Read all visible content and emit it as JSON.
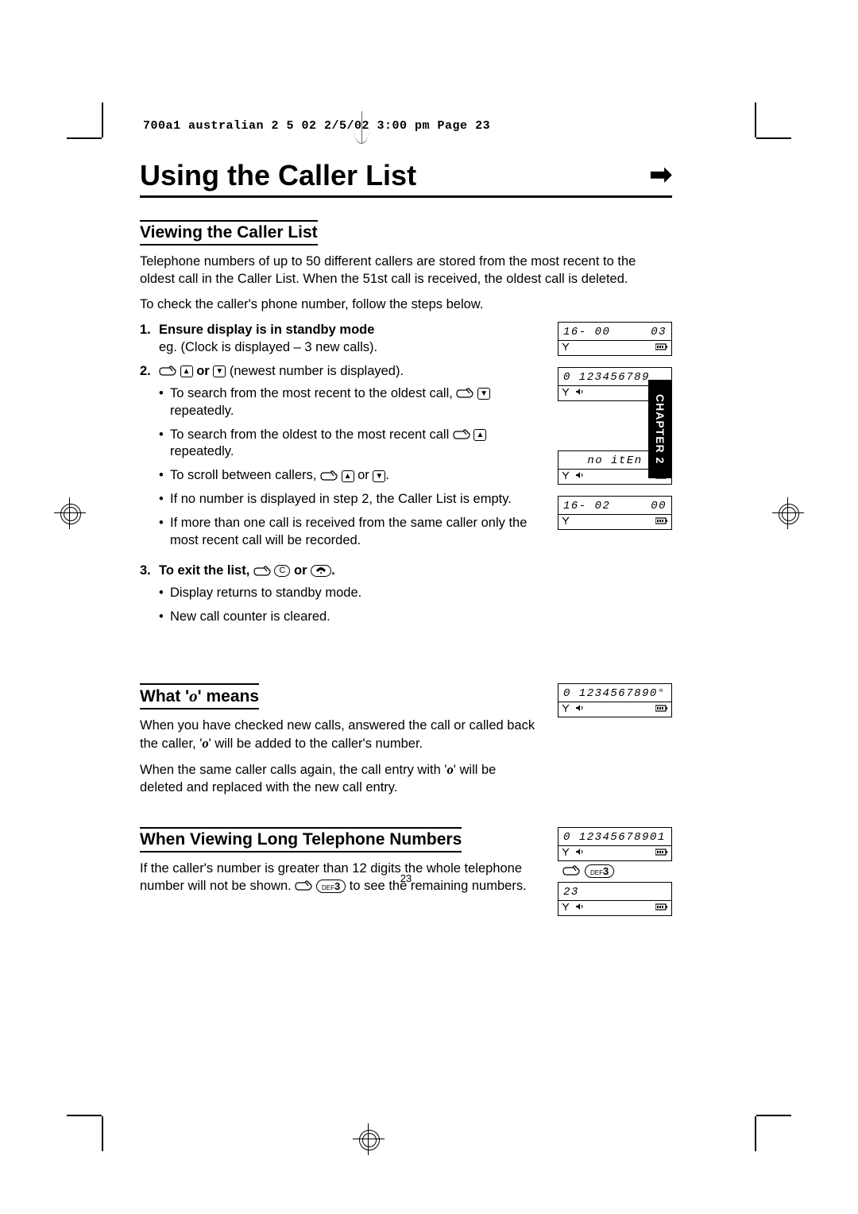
{
  "header": "700a1  australian 2 5 02  2/5/02  3:00 pm  Page 23",
  "title": "Using the Caller List",
  "chapter_tab": "CHAPTER 2",
  "page_number": "23",
  "section1": {
    "heading": "Viewing the Caller List",
    "intro1": "Telephone numbers of up to 50 different callers are stored from the most recent to the oldest call in the Caller List. When the 51st call is received, the oldest call is deleted.",
    "intro2": "To check the caller's phone number, follow the steps below.",
    "step1_num": "1.",
    "step1_title": "Ensure display is in standby mode",
    "step1_sub": "eg. (Clock is displayed – 3 new calls).",
    "step2_num": "2.",
    "step2_pre": " ",
    "step2_or": " or ",
    "step2_post": " (newest number is displayed).",
    "step2_b1a": "To search from the most recent to the oldest call, ",
    "step2_b1b": " repeatedly.",
    "step2_b2a": "To search from the oldest to the most recent call ",
    "step2_b2b": " repeatedly.",
    "step2_b3a": "To scroll between callers, ",
    "step2_b3b": " or ",
    "step2_b3c": ".",
    "step2_b4": "If no number is displayed in step 2, the Caller List is empty.",
    "step2_b5": "If more than one call is received from the same caller only the most recent call will be recorded.",
    "step3_num": "3.",
    "step3_title_a": "To exit the list, ",
    "step3_title_b": " or ",
    "step3_title_c": ".",
    "step3_b1": "Display returns to standby mode.",
    "step3_b2": "New call counter is cleared."
  },
  "lcd": {
    "d1_left": "16- 00",
    "d1_right": "03",
    "d2_left": "0 123456789",
    "d3_center": "no itEn",
    "d4_left": "16- 02",
    "d4_right": "00",
    "d5_left": "0 1234567890°",
    "d6_left": "0 12345678901",
    "d6b_left": "23"
  },
  "section2": {
    "heading_a": "What '",
    "heading_b": "' means",
    "p1a": "When you have checked new calls, answered the call or called back the caller, '",
    "p1b": "' will be added to the caller's number.",
    "p2a": "When the same caller calls again, the call entry with '",
    "p2b": "' will be deleted and replaced with the new call entry."
  },
  "section3": {
    "heading": "When Viewing Long Telephone Numbers",
    "p1a": "If the caller's number is greater than 12 digits the whole telephone number will not be shown. ",
    "p1b": " to see the remaining numbers."
  },
  "keys": {
    "c": "C",
    "def": "DEF",
    "three": "3"
  }
}
